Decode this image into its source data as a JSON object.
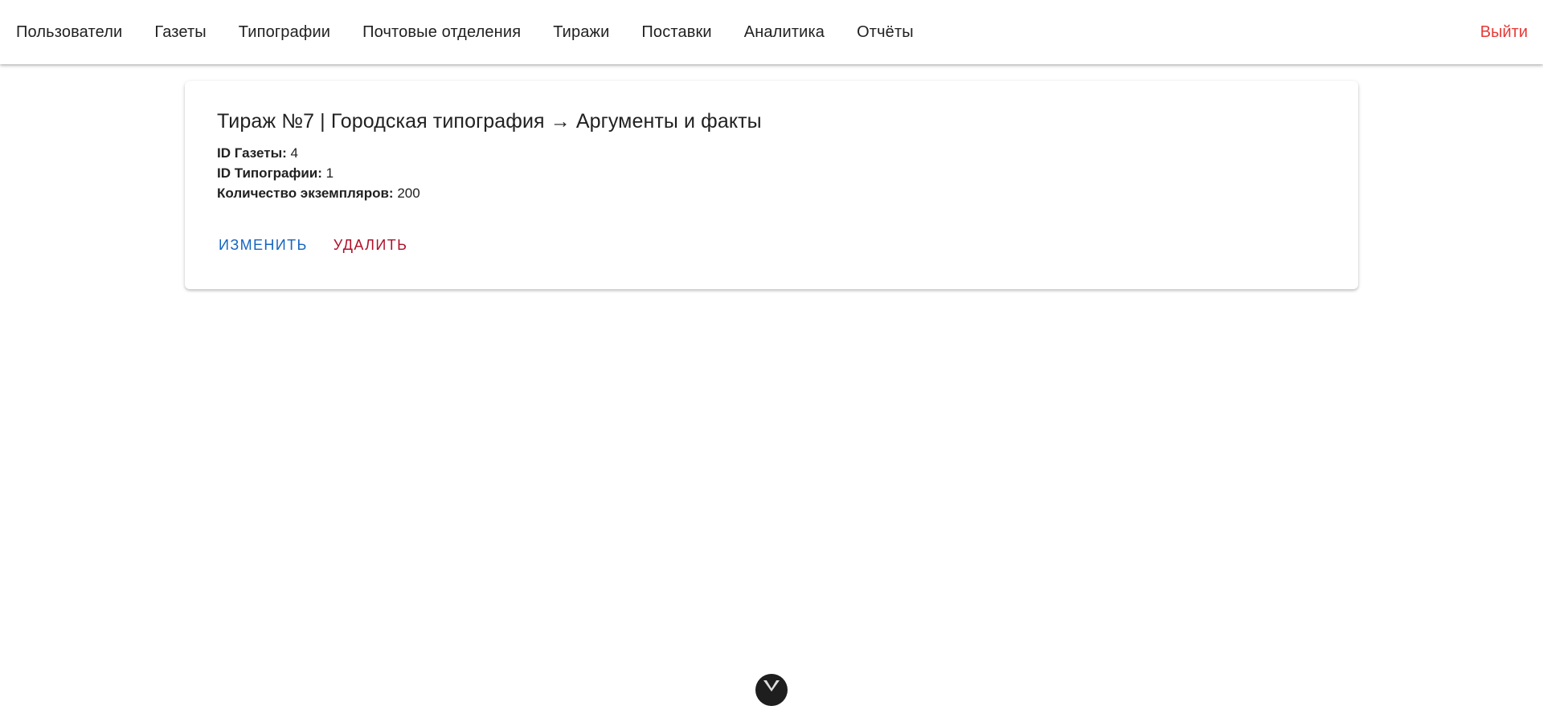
{
  "nav": {
    "items": [
      {
        "label": "Пользователи"
      },
      {
        "label": "Газеты"
      },
      {
        "label": "Типографии"
      },
      {
        "label": "Почтовые отделения"
      },
      {
        "label": "Тиражи"
      },
      {
        "label": "Поставки"
      },
      {
        "label": "Аналитика"
      },
      {
        "label": "Отчёты"
      }
    ],
    "logout_label": "Выйти",
    "logout_color": "#e53935"
  },
  "card": {
    "title": "Тираж №7 | Городская типография → Аргументы и факты",
    "fields": [
      {
        "label": "ID Газеты:",
        "value": "4"
      },
      {
        "label": "ID Типографии:",
        "value": "1"
      },
      {
        "label": "Количество экземпляров:",
        "value": "200"
      }
    ],
    "edit_label": "ИЗМЕНИТЬ",
    "delete_label": "УДАЛИТЬ",
    "edit_color": "#1565c0",
    "delete_color": "#b0102a"
  },
  "devtools": {
    "icon": "vue-devtools-icon"
  }
}
